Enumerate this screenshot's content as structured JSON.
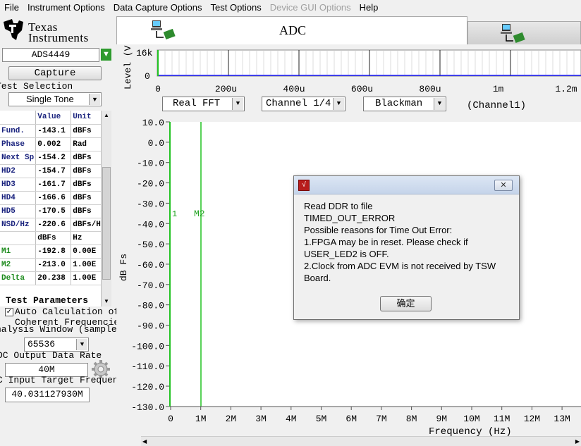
{
  "menu": [
    "File",
    "Instrument Options",
    "Data Capture Options",
    "Test Options",
    "Device GUI Options",
    "Help"
  ],
  "menu_disabled": [
    "Device GUI Options"
  ],
  "logo": {
    "line1": "Texas",
    "line2": "Instruments"
  },
  "device": {
    "value": "ADS4449"
  },
  "capture_label": "Capture",
  "test_selection": {
    "label": "Test Selection",
    "value": "Single Tone"
  },
  "table": {
    "headers": [
      "",
      "Value",
      "Unit"
    ],
    "rows": [
      [
        "Fund.",
        "-143.1",
        "dBFs"
      ],
      [
        "Phase",
        "0.002",
        "Rad"
      ],
      [
        "Next Sp",
        "-154.2",
        "dBFs"
      ],
      [
        "HD2",
        "-154.7",
        "dBFs"
      ],
      [
        "HD3",
        "-161.7",
        "dBFs"
      ],
      [
        "HD4",
        "-166.6",
        "dBFs"
      ],
      [
        "HD5",
        "-170.5",
        "dBFs"
      ],
      [
        "NSD/Hz",
        "-220.6",
        "dBFs/H"
      ],
      [
        "",
        "dBFs",
        "Hz"
      ],
      [
        "M1",
        "-192.8",
        "0.00E"
      ],
      [
        "M2",
        "-213.0",
        "1.00E"
      ],
      [
        "Delta",
        "20.238",
        "1.00E"
      ]
    ]
  },
  "test_params": {
    "title": "Test Parameters",
    "auto_calc_label": "Auto Calculation of",
    "auto_calc_label2": "Coherent Frequencies",
    "analysis_window_label": "nalysis Window (samples)",
    "analysis_window_value": "65536",
    "adc_rate_label": "DC Output Data Rate",
    "adc_rate_value": "40M",
    "input_freq_label": "C Input Target Frequenc",
    "input_freq_value": "40.031127930M"
  },
  "tabs": {
    "adc": "ADC"
  },
  "time_plot": {
    "ylabel": "Level (V",
    "y_ticks": [
      "16k",
      "0"
    ],
    "x_ticks": [
      "0",
      "200u",
      "400u",
      "600u",
      "800u",
      "1m",
      "1.2m"
    ]
  },
  "controls": {
    "fft": "Real FFT",
    "channel": "Channel 1/4",
    "window": "Blackman",
    "channel_note": "(Channel1)"
  },
  "fft_plot": {
    "ylabel": "dB Fs",
    "xlabel": "Frequency (Hz)",
    "y_ticks": [
      "10.0",
      "0.0",
      "-10.0",
      "-20.0",
      "-30.0",
      "-40.0",
      "-50.0",
      "-60.0",
      "-70.0",
      "-80.0",
      "-90.0",
      "-100.0",
      "-110.0",
      "-120.0",
      "-130.0"
    ],
    "x_ticks": [
      "0",
      "1M",
      "2M",
      "3M",
      "4M",
      "5M",
      "6M",
      "7M",
      "8M",
      "9M",
      "10M",
      "11M",
      "12M",
      "13M"
    ],
    "marker_m1": "1",
    "marker_m2": "M2"
  },
  "dialog": {
    "lines": [
      "Read DDR to file",
      "TIMED_OUT_ERROR",
      "Possible reasons for Time Out Error:",
      "1.FPGA may be in reset. Please check if",
      "USER_LED2 is OFF.",
      "2.Clock from ADC EVM is not received by TSW",
      "Board."
    ],
    "ok": "确定"
  }
}
